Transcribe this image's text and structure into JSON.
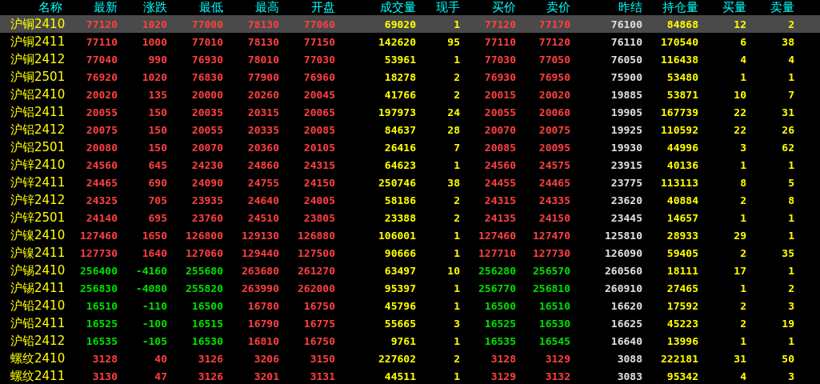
{
  "columns": [
    {
      "label": "名称",
      "kind": "name"
    },
    {
      "label": "最新",
      "kind": "price"
    },
    {
      "label": "涨跌",
      "kind": "price"
    },
    {
      "label": "最低",
      "kind": "price"
    },
    {
      "label": "最高",
      "kind": "price"
    },
    {
      "label": "开盘",
      "kind": "price"
    },
    {
      "label": "成交量",
      "kind": "volume"
    },
    {
      "label": "现手",
      "kind": "volume"
    },
    {
      "label": "买价",
      "kind": "price"
    },
    {
      "label": "卖价",
      "kind": "price"
    },
    {
      "label": "昨结",
      "kind": "settle"
    },
    {
      "label": "持仓量",
      "kind": "volume"
    },
    {
      "label": "买量",
      "kind": "volume"
    },
    {
      "label": "卖量",
      "kind": "volume"
    }
  ],
  "rows": [
    {
      "name": "沪铜2410",
      "selected": true,
      "cells": [
        {
          "text": "77120",
          "falling": false
        },
        {
          "text": "1020",
          "falling": false
        },
        {
          "text": "77000",
          "falling": false
        },
        {
          "text": "78130",
          "falling": false
        },
        {
          "text": "77060",
          "falling": false
        },
        {
          "text": "69020"
        },
        {
          "text": "1"
        },
        {
          "text": "77120",
          "falling": false
        },
        {
          "text": "77170",
          "falling": false
        },
        {
          "text": "76100"
        },
        {
          "text": "84868"
        },
        {
          "text": "12"
        },
        {
          "text": "2"
        }
      ]
    },
    {
      "name": "沪铜2411",
      "selected": false,
      "cells": [
        {
          "text": "77110",
          "falling": false
        },
        {
          "text": "1000",
          "falling": false
        },
        {
          "text": "77010",
          "falling": false
        },
        {
          "text": "78130",
          "falling": false
        },
        {
          "text": "77150",
          "falling": false
        },
        {
          "text": "142620"
        },
        {
          "text": "95"
        },
        {
          "text": "77110",
          "falling": false
        },
        {
          "text": "77120",
          "falling": false
        },
        {
          "text": "76110"
        },
        {
          "text": "170540"
        },
        {
          "text": "6"
        },
        {
          "text": "38"
        }
      ]
    },
    {
      "name": "沪铜2412",
      "selected": false,
      "cells": [
        {
          "text": "77040",
          "falling": false
        },
        {
          "text": "990",
          "falling": false
        },
        {
          "text": "76930",
          "falling": false
        },
        {
          "text": "78010",
          "falling": false
        },
        {
          "text": "77030",
          "falling": false
        },
        {
          "text": "53961"
        },
        {
          "text": "1"
        },
        {
          "text": "77030",
          "falling": false
        },
        {
          "text": "77050",
          "falling": false
        },
        {
          "text": "76050"
        },
        {
          "text": "116438"
        },
        {
          "text": "4"
        },
        {
          "text": "4"
        }
      ]
    },
    {
      "name": "沪铜2501",
      "selected": false,
      "cells": [
        {
          "text": "76920",
          "falling": false
        },
        {
          "text": "1020",
          "falling": false
        },
        {
          "text": "76830",
          "falling": false
        },
        {
          "text": "77900",
          "falling": false
        },
        {
          "text": "76960",
          "falling": false
        },
        {
          "text": "18278"
        },
        {
          "text": "2"
        },
        {
          "text": "76930",
          "falling": false
        },
        {
          "text": "76950",
          "falling": false
        },
        {
          "text": "75900"
        },
        {
          "text": "53480"
        },
        {
          "text": "1"
        },
        {
          "text": "1"
        }
      ]
    },
    {
      "name": "沪铝2410",
      "selected": false,
      "cells": [
        {
          "text": "20020",
          "falling": false
        },
        {
          "text": "135",
          "falling": false
        },
        {
          "text": "20000",
          "falling": false
        },
        {
          "text": "20260",
          "falling": false
        },
        {
          "text": "20045",
          "falling": false
        },
        {
          "text": "41766"
        },
        {
          "text": "2"
        },
        {
          "text": "20015",
          "falling": false
        },
        {
          "text": "20020",
          "falling": false
        },
        {
          "text": "19885"
        },
        {
          "text": "53871"
        },
        {
          "text": "10"
        },
        {
          "text": "7"
        }
      ]
    },
    {
      "name": "沪铝2411",
      "selected": false,
      "cells": [
        {
          "text": "20055",
          "falling": false
        },
        {
          "text": "150",
          "falling": false
        },
        {
          "text": "20035",
          "falling": false
        },
        {
          "text": "20315",
          "falling": false
        },
        {
          "text": "20065",
          "falling": false
        },
        {
          "text": "197973"
        },
        {
          "text": "24"
        },
        {
          "text": "20055",
          "falling": false
        },
        {
          "text": "20060",
          "falling": false
        },
        {
          "text": "19905"
        },
        {
          "text": "167739"
        },
        {
          "text": "22"
        },
        {
          "text": "31"
        }
      ]
    },
    {
      "name": "沪铝2412",
      "selected": false,
      "cells": [
        {
          "text": "20075",
          "falling": false
        },
        {
          "text": "150",
          "falling": false
        },
        {
          "text": "20055",
          "falling": false
        },
        {
          "text": "20335",
          "falling": false
        },
        {
          "text": "20085",
          "falling": false
        },
        {
          "text": "84637"
        },
        {
          "text": "28"
        },
        {
          "text": "20070",
          "falling": false
        },
        {
          "text": "20075",
          "falling": false
        },
        {
          "text": "19925"
        },
        {
          "text": "110592"
        },
        {
          "text": "22"
        },
        {
          "text": "26"
        }
      ]
    },
    {
      "name": "沪铝2501",
      "selected": false,
      "cells": [
        {
          "text": "20080",
          "falling": false
        },
        {
          "text": "150",
          "falling": false
        },
        {
          "text": "20070",
          "falling": false
        },
        {
          "text": "20360",
          "falling": false
        },
        {
          "text": "20105",
          "falling": false
        },
        {
          "text": "26416"
        },
        {
          "text": "7"
        },
        {
          "text": "20085",
          "falling": false
        },
        {
          "text": "20095",
          "falling": false
        },
        {
          "text": "19930"
        },
        {
          "text": "44996"
        },
        {
          "text": "3"
        },
        {
          "text": "62"
        }
      ]
    },
    {
      "name": "沪锌2410",
      "selected": false,
      "cells": [
        {
          "text": "24560",
          "falling": false
        },
        {
          "text": "645",
          "falling": false
        },
        {
          "text": "24230",
          "falling": false
        },
        {
          "text": "24860",
          "falling": false
        },
        {
          "text": "24315",
          "falling": false
        },
        {
          "text": "64623"
        },
        {
          "text": "1"
        },
        {
          "text": "24560",
          "falling": false
        },
        {
          "text": "24575",
          "falling": false
        },
        {
          "text": "23915"
        },
        {
          "text": "40136"
        },
        {
          "text": "1"
        },
        {
          "text": "1"
        }
      ]
    },
    {
      "name": "沪锌2411",
      "selected": false,
      "cells": [
        {
          "text": "24465",
          "falling": false
        },
        {
          "text": "690",
          "falling": false
        },
        {
          "text": "24090",
          "falling": false
        },
        {
          "text": "24755",
          "falling": false
        },
        {
          "text": "24150",
          "falling": false
        },
        {
          "text": "250746"
        },
        {
          "text": "38"
        },
        {
          "text": "24455",
          "falling": false
        },
        {
          "text": "24465",
          "falling": false
        },
        {
          "text": "23775"
        },
        {
          "text": "113113"
        },
        {
          "text": "8"
        },
        {
          "text": "5"
        }
      ]
    },
    {
      "name": "沪锌2412",
      "selected": false,
      "cells": [
        {
          "text": "24325",
          "falling": false
        },
        {
          "text": "705",
          "falling": false
        },
        {
          "text": "23935",
          "falling": false
        },
        {
          "text": "24640",
          "falling": false
        },
        {
          "text": "24005",
          "falling": false
        },
        {
          "text": "58186"
        },
        {
          "text": "2"
        },
        {
          "text": "24315",
          "falling": false
        },
        {
          "text": "24335",
          "falling": false
        },
        {
          "text": "23620"
        },
        {
          "text": "40884"
        },
        {
          "text": "2"
        },
        {
          "text": "8"
        }
      ]
    },
    {
      "name": "沪锌2501",
      "selected": false,
      "cells": [
        {
          "text": "24140",
          "falling": false
        },
        {
          "text": "695",
          "falling": false
        },
        {
          "text": "23760",
          "falling": false
        },
        {
          "text": "24510",
          "falling": false
        },
        {
          "text": "23805",
          "falling": false
        },
        {
          "text": "23388"
        },
        {
          "text": "2"
        },
        {
          "text": "24135",
          "falling": false
        },
        {
          "text": "24150",
          "falling": false
        },
        {
          "text": "23445"
        },
        {
          "text": "14657"
        },
        {
          "text": "1"
        },
        {
          "text": "1"
        }
      ]
    },
    {
      "name": "沪镍2410",
      "selected": false,
      "cells": [
        {
          "text": "127460",
          "falling": false
        },
        {
          "text": "1650",
          "falling": false
        },
        {
          "text": "126800",
          "falling": false
        },
        {
          "text": "129130",
          "falling": false
        },
        {
          "text": "126880",
          "falling": false
        },
        {
          "text": "106001"
        },
        {
          "text": "1"
        },
        {
          "text": "127460",
          "falling": false
        },
        {
          "text": "127470",
          "falling": false
        },
        {
          "text": "125810"
        },
        {
          "text": "28933"
        },
        {
          "text": "29"
        },
        {
          "text": "1"
        }
      ]
    },
    {
      "name": "沪镍2411",
      "selected": false,
      "cells": [
        {
          "text": "127730",
          "falling": false
        },
        {
          "text": "1640",
          "falling": false
        },
        {
          "text": "127060",
          "falling": false
        },
        {
          "text": "129440",
          "falling": false
        },
        {
          "text": "127500",
          "falling": false
        },
        {
          "text": "90666"
        },
        {
          "text": "1"
        },
        {
          "text": "127710",
          "falling": false
        },
        {
          "text": "127730",
          "falling": false
        },
        {
          "text": "126090"
        },
        {
          "text": "59405"
        },
        {
          "text": "2"
        },
        {
          "text": "35"
        }
      ]
    },
    {
      "name": "沪锡2410",
      "selected": false,
      "cells": [
        {
          "text": "256400",
          "falling": true
        },
        {
          "text": "-4160",
          "falling": true
        },
        {
          "text": "255680",
          "falling": true
        },
        {
          "text": "263680",
          "falling": false
        },
        {
          "text": "261270",
          "falling": false
        },
        {
          "text": "63497"
        },
        {
          "text": "10"
        },
        {
          "text": "256280",
          "falling": true
        },
        {
          "text": "256570",
          "falling": true
        },
        {
          "text": "260560"
        },
        {
          "text": "18111"
        },
        {
          "text": "17"
        },
        {
          "text": "1"
        }
      ]
    },
    {
      "name": "沪锡2411",
      "selected": false,
      "cells": [
        {
          "text": "256830",
          "falling": true
        },
        {
          "text": "-4080",
          "falling": true
        },
        {
          "text": "255820",
          "falling": true
        },
        {
          "text": "263990",
          "falling": false
        },
        {
          "text": "262000",
          "falling": false
        },
        {
          "text": "95397"
        },
        {
          "text": "1"
        },
        {
          "text": "256770",
          "falling": true
        },
        {
          "text": "256810",
          "falling": true
        },
        {
          "text": "260910"
        },
        {
          "text": "27465"
        },
        {
          "text": "1"
        },
        {
          "text": "2"
        }
      ]
    },
    {
      "name": "沪铅2410",
      "selected": false,
      "cells": [
        {
          "text": "16510",
          "falling": true
        },
        {
          "text": "-110",
          "falling": true
        },
        {
          "text": "16500",
          "falling": true
        },
        {
          "text": "16780",
          "falling": false
        },
        {
          "text": "16750",
          "falling": false
        },
        {
          "text": "45796"
        },
        {
          "text": "1"
        },
        {
          "text": "16500",
          "falling": true
        },
        {
          "text": "16510",
          "falling": true
        },
        {
          "text": "16620"
        },
        {
          "text": "17592"
        },
        {
          "text": "2"
        },
        {
          "text": "3"
        }
      ]
    },
    {
      "name": "沪铅2411",
      "selected": false,
      "cells": [
        {
          "text": "16525",
          "falling": true
        },
        {
          "text": "-100",
          "falling": true
        },
        {
          "text": "16515",
          "falling": true
        },
        {
          "text": "16790",
          "falling": false
        },
        {
          "text": "16775",
          "falling": false
        },
        {
          "text": "55665"
        },
        {
          "text": "3"
        },
        {
          "text": "16525",
          "falling": true
        },
        {
          "text": "16530",
          "falling": true
        },
        {
          "text": "16625"
        },
        {
          "text": "45223"
        },
        {
          "text": "2"
        },
        {
          "text": "19"
        }
      ]
    },
    {
      "name": "沪铅2412",
      "selected": false,
      "cells": [
        {
          "text": "16535",
          "falling": true
        },
        {
          "text": "-105",
          "falling": true
        },
        {
          "text": "16530",
          "falling": true
        },
        {
          "text": "16810",
          "falling": false
        },
        {
          "text": "16750",
          "falling": false
        },
        {
          "text": "9761"
        },
        {
          "text": "1"
        },
        {
          "text": "16535",
          "falling": true
        },
        {
          "text": "16545",
          "falling": true
        },
        {
          "text": "16640"
        },
        {
          "text": "13996"
        },
        {
          "text": "1"
        },
        {
          "text": "1"
        }
      ]
    },
    {
      "name": "螺纹2410",
      "selected": false,
      "cells": [
        {
          "text": "3128",
          "falling": false
        },
        {
          "text": "40",
          "falling": false
        },
        {
          "text": "3126",
          "falling": false
        },
        {
          "text": "3206",
          "falling": false
        },
        {
          "text": "3150",
          "falling": false
        },
        {
          "text": "227602"
        },
        {
          "text": "2"
        },
        {
          "text": "3128",
          "falling": false
        },
        {
          "text": "3129",
          "falling": false
        },
        {
          "text": "3088"
        },
        {
          "text": "222181"
        },
        {
          "text": "31"
        },
        {
          "text": "50"
        }
      ]
    },
    {
      "name": "螺纹2411",
      "selected": false,
      "cells": [
        {
          "text": "3130",
          "falling": false
        },
        {
          "text": "47",
          "falling": false
        },
        {
          "text": "3126",
          "falling": false
        },
        {
          "text": "3201",
          "falling": false
        },
        {
          "text": "3131",
          "falling": false
        },
        {
          "text": "44511"
        },
        {
          "text": "1"
        },
        {
          "text": "3129",
          "falling": false
        },
        {
          "text": "3132",
          "falling": false
        },
        {
          "text": "3083"
        },
        {
          "text": "95342"
        },
        {
          "text": "4"
        },
        {
          "text": "3"
        }
      ]
    }
  ]
}
